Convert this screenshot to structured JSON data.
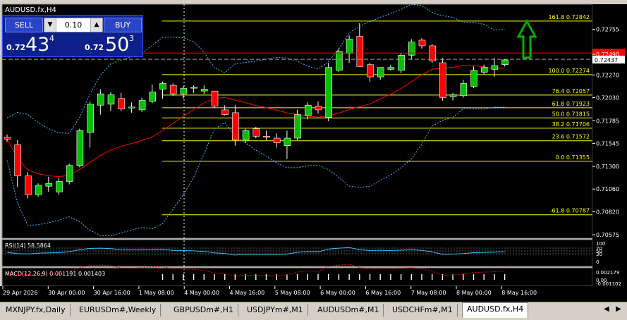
{
  "window": {
    "title": "AUDUSD.fx,H4"
  },
  "trade_panel": {
    "sell_label": "SELL",
    "buy_label": "BUY",
    "lot": "0.10",
    "sell": {
      "prefix": "0.72",
      "big": "43",
      "sup": "4"
    },
    "buy": {
      "prefix": "0.72",
      "big": "50",
      "sup": "3"
    }
  },
  "tabs": [
    "MXNJPY.fx,Daily",
    "EURUSDm#,Weekly",
    "GBPUSDm#,H1",
    "USDJPYm#,M1",
    "AUDUSDm#,M1",
    "USDCHFm#,M1",
    "AUDUSD.fx,H4"
  ],
  "active_tab": 6,
  "colors": {
    "bg": "#000000",
    "bull": "#00c000",
    "bear": "#ff0000",
    "fib": "#ffff00",
    "band": "#40c0ff",
    "ma": "#ff0000",
    "text": "#ffffff"
  },
  "chart_data": {
    "type": "candlestick",
    "title": "AUDUSD.fx,H4",
    "ylim": [
      0.70538,
      0.73021
    ],
    "yticks": [
      "0.72755",
      "0.72490",
      "0.72270",
      "0.72030",
      "0.71785",
      "0.71545",
      "0.71300",
      "0.71060",
      "0.70820",
      "0.70575"
    ],
    "xticks": [
      "29 Apr 2026",
      "30 Apr 00:00",
      "30 Apr 16:00",
      "1 May 08:00",
      "4 May 00:00",
      "4 May 16:00",
      "5 May 08:00",
      "6 May 00:00",
      "6 May 16:00",
      "7 May 08:00",
      "8 May 00:00",
      "8 May 16:00"
    ],
    "current_price": "0.72437",
    "ask_price": "0.72503",
    "candles": [
      [
        0.7161,
        0.7164,
        0.7156,
        0.7159
      ],
      [
        0.7153,
        0.7158,
        0.7108,
        0.712
      ],
      [
        0.712,
        0.7124,
        0.7096,
        0.71
      ],
      [
        0.71,
        0.7112,
        0.7098,
        0.711
      ],
      [
        0.7109,
        0.7119,
        0.7103,
        0.7112
      ],
      [
        0.7103,
        0.7118,
        0.71,
        0.7114
      ],
      [
        0.7114,
        0.7133,
        0.7111,
        0.7131
      ],
      [
        0.7131,
        0.717,
        0.7129,
        0.7168
      ],
      [
        0.7166,
        0.7199,
        0.715,
        0.7196
      ],
      [
        0.7195,
        0.7212,
        0.7185,
        0.7207
      ],
      [
        0.7196,
        0.7209,
        0.7189,
        0.7206
      ],
      [
        0.7202,
        0.7208,
        0.7189,
        0.7191
      ],
      [
        0.7193,
        0.7198,
        0.7187,
        0.7192
      ],
      [
        0.719,
        0.7203,
        0.7188,
        0.72
      ],
      [
        0.7199,
        0.7217,
        0.7197,
        0.7209
      ],
      [
        0.7212,
        0.722,
        0.7202,
        0.7218
      ],
      [
        0.7216,
        0.7218,
        0.7205,
        0.7207
      ],
      [
        0.7207,
        0.7215,
        0.7202,
        0.7213
      ],
      [
        0.7213,
        0.7216,
        0.7208,
        0.7214
      ],
      [
        0.721,
        0.7216,
        0.7207,
        0.7212
      ],
      [
        0.721,
        0.721,
        0.7192,
        0.7194
      ],
      [
        0.719,
        0.7195,
        0.7184,
        0.7185
      ],
      [
        0.7187,
        0.7195,
        0.7152,
        0.7158
      ],
      [
        0.7158,
        0.717,
        0.7155,
        0.7168
      ],
      [
        0.717,
        0.7172,
        0.716,
        0.7162
      ],
      [
        0.7162,
        0.7168,
        0.7158,
        0.7161
      ],
      [
        0.716,
        0.7165,
        0.715,
        0.7155
      ],
      [
        0.7152,
        0.7168,
        0.7138,
        0.716
      ],
      [
        0.716,
        0.719,
        0.7158,
        0.7185
      ],
      [
        0.7184,
        0.7198,
        0.718,
        0.7195
      ],
      [
        0.7194,
        0.7199,
        0.7186,
        0.719
      ],
      [
        0.7182,
        0.724,
        0.7178,
        0.7235
      ],
      [
        0.7232,
        0.7255,
        0.723,
        0.7252
      ],
      [
        0.725,
        0.7269,
        0.724,
        0.7265
      ],
      [
        0.7268,
        0.7282,
        0.724,
        0.7236
      ],
      [
        0.7238,
        0.724,
        0.722,
        0.7225
      ],
      [
        0.7225,
        0.7235,
        0.7222,
        0.7235
      ],
      [
        0.7233,
        0.7238,
        0.7232,
        0.7235
      ],
      [
        0.7232,
        0.725,
        0.7229,
        0.7248
      ],
      [
        0.7248,
        0.7265,
        0.7244,
        0.7262
      ],
      [
        0.7264,
        0.7266,
        0.7255,
        0.7258
      ],
      [
        0.7258,
        0.726,
        0.724,
        0.7242
      ],
      [
        0.724,
        0.7245,
        0.72,
        0.7203
      ],
      [
        0.7204,
        0.7208,
        0.72,
        0.7206
      ],
      [
        0.7205,
        0.7222,
        0.7203,
        0.7218
      ],
      [
        0.7215,
        0.7236,
        0.7213,
        0.7232
      ],
      [
        0.723,
        0.7238,
        0.7228,
        0.7235
      ],
      [
        0.7233,
        0.7245,
        0.7225,
        0.7237
      ],
      [
        0.7238,
        0.7244,
        0.7236,
        0.7243
      ]
    ],
    "fibonacci": [
      {
        "level": "161.8",
        "price": "0.72842",
        "value": 0.72842
      },
      {
        "level": "100.0",
        "price": "0.72274",
        "value": 0.72274
      },
      {
        "level": "76.4",
        "price": "0.72057",
        "value": 0.72057
      },
      {
        "level": "61.8",
        "price": "0.71923",
        "value": 0.71923
      },
      {
        "level": "50.0",
        "price": "0.71815",
        "value": 0.71815
      },
      {
        "level": "38.2",
        "price": "0.71706",
        "value": 0.71706
      },
      {
        "level": "23.6",
        "price": "0.71572",
        "value": 0.71572
      },
      {
        "level": "0.0",
        "price": "0.71355",
        "value": 0.71355
      },
      {
        "level": "-61.8",
        "price": "0.70787",
        "value": 0.70787
      }
    ],
    "rsi": {
      "label": "RSI(14) 58.5864",
      "ticks": [
        "100",
        "70",
        "50",
        "30",
        "0"
      ]
    },
    "macd": {
      "label": "MACD(12,26,9) 0.001191 0.001403",
      "ticks": [
        "0.002179",
        "0.00",
        "-0.001102"
      ]
    }
  }
}
